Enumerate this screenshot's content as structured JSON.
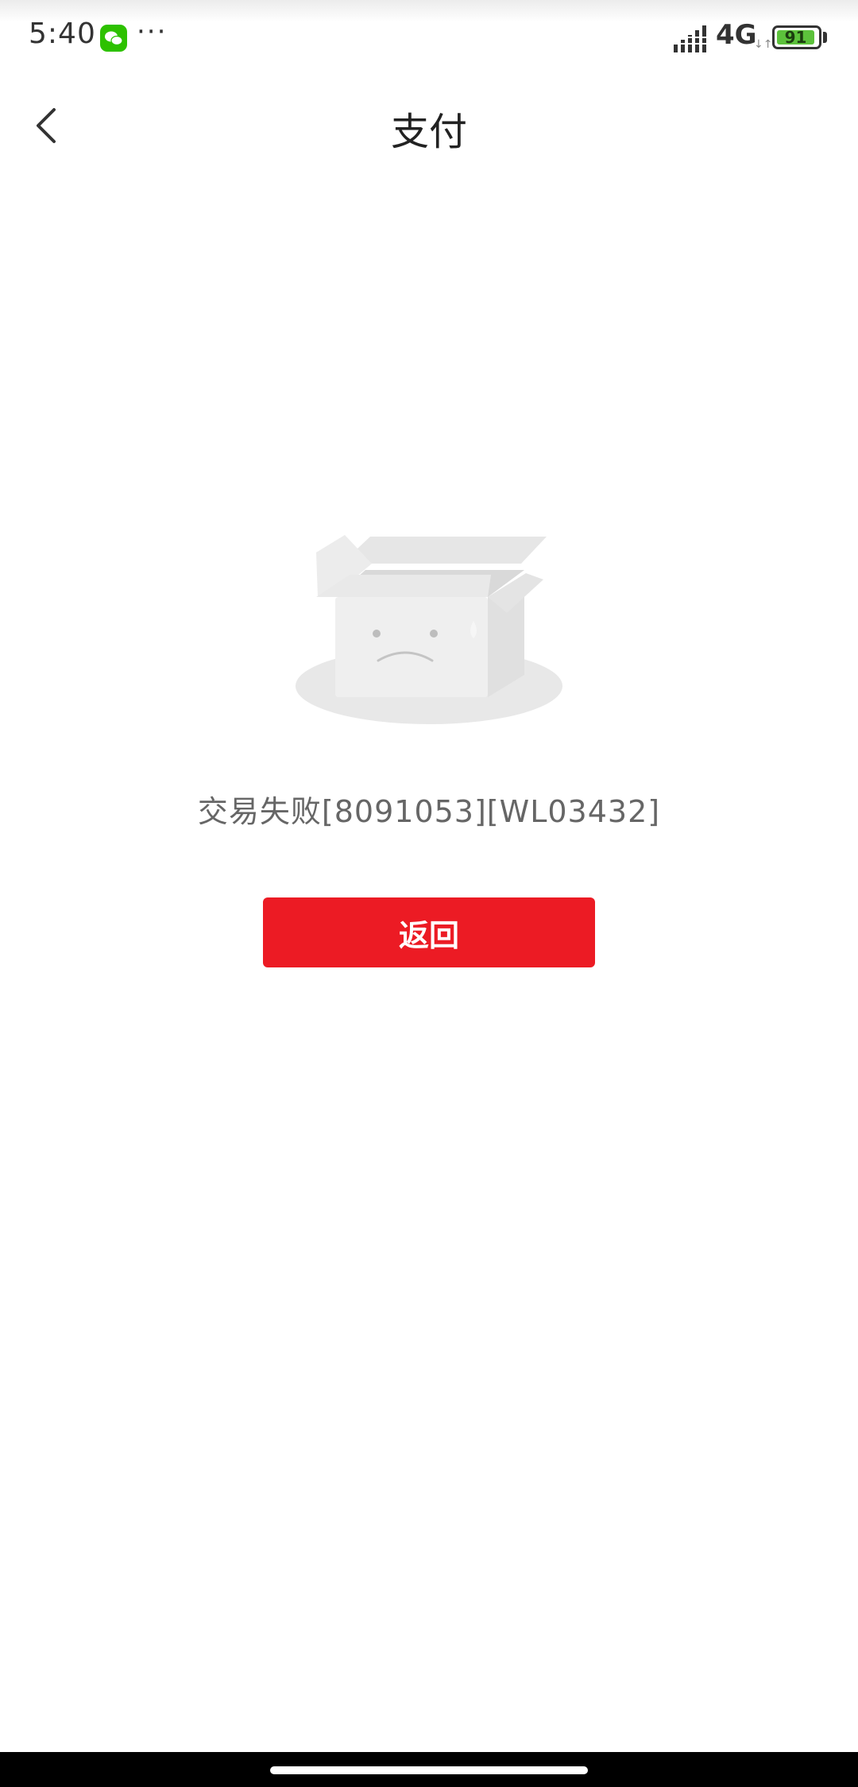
{
  "status_bar": {
    "time": "5:40",
    "more": "···",
    "network": "4G",
    "network_arrows": "↓↑",
    "battery_level": "91"
  },
  "header": {
    "title": "支付"
  },
  "main": {
    "error_message": "交易失败[8091053][WL03432]",
    "return_label": "返回"
  },
  "colors": {
    "accent": "#ec1b24",
    "battery": "#5cc23b",
    "wechat": "#2dc100"
  },
  "icons": {
    "back": "back-chevron-icon",
    "illustration": "empty-box-sad-face-icon",
    "app_notification": "wechat-icon"
  }
}
